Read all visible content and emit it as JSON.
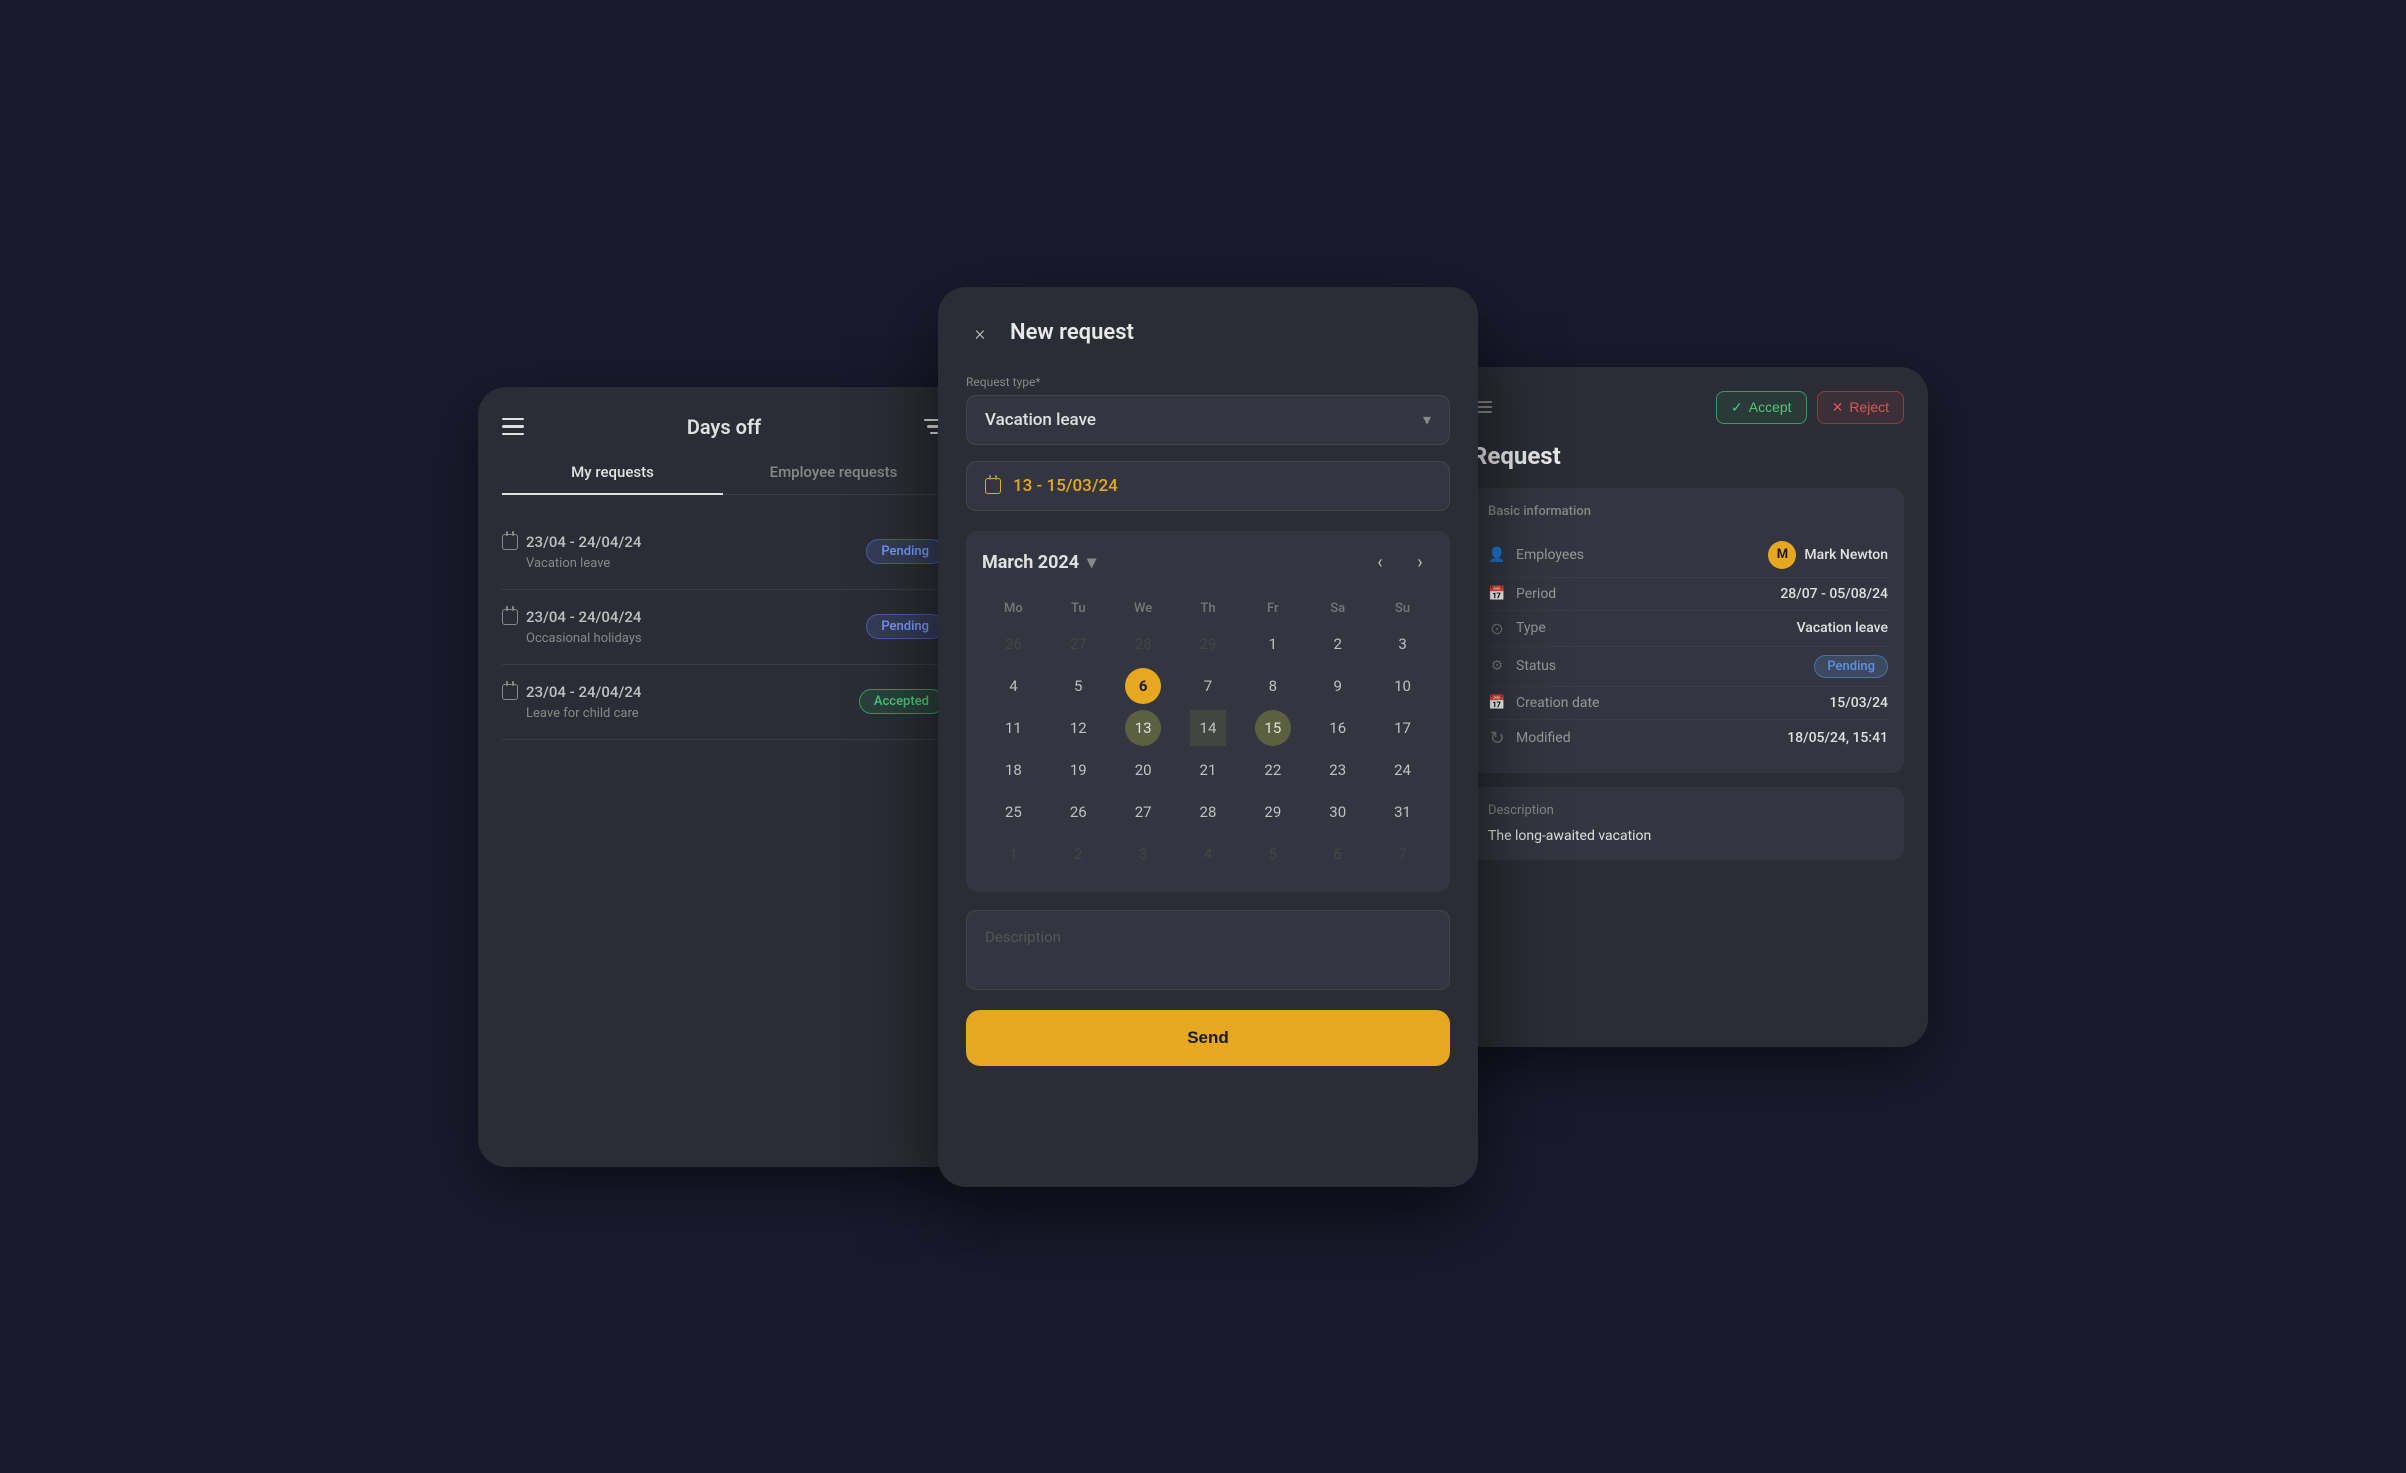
{
  "panel1": {
    "title": "Days off",
    "tabs": [
      {
        "label": "My requests",
        "active": true
      },
      {
        "label": "Employee requests",
        "active": false
      }
    ],
    "requests": [
      {
        "date": "23/04 - 24/04/24",
        "type": "Vacation leave",
        "status": "Pending",
        "statusType": "pending"
      },
      {
        "date": "23/04 - 24/04/24",
        "type": "Occasional holidays",
        "status": "Pending",
        "statusType": "pending"
      },
      {
        "date": "23/04 - 24/04/24",
        "type": "Leave for child care",
        "status": "Accepted",
        "statusType": "accepted"
      }
    ]
  },
  "panel2": {
    "title": "New request",
    "close_label": "×",
    "request_type_label": "Request type*",
    "request_type_value": "Vacation leave",
    "date_range": "13 - 15/03/24",
    "calendar": {
      "month": "March 2024",
      "weekdays": [
        "Mo",
        "Tu",
        "We",
        "Th",
        "Fr",
        "Sa",
        "Su"
      ],
      "rows": [
        [
          "26",
          "27",
          "28",
          "29",
          "1",
          "2",
          "3"
        ],
        [
          "4",
          "5",
          "6",
          "7",
          "8",
          "9",
          "10"
        ],
        [
          "11",
          "12",
          "13",
          "14",
          "15",
          "16",
          "17"
        ],
        [
          "18",
          "19",
          "20",
          "21",
          "22",
          "23",
          "24"
        ],
        [
          "25",
          "26",
          "27",
          "28",
          "29",
          "30",
          "31"
        ],
        [
          "1",
          "2",
          "3",
          "4",
          "5",
          "6",
          "7"
        ]
      ],
      "today_cell": "6",
      "selected_start": "13",
      "selected_end": "15",
      "in_range": [
        "14"
      ]
    },
    "description_placeholder": "Description",
    "send_label": "Send"
  },
  "panel3": {
    "section_title": "Request",
    "basic_info_label": "Basic information",
    "accept_label": "Accept",
    "reject_label": "Reject",
    "fields": [
      {
        "key": "Employees",
        "value": "Mark Newton",
        "icon": "person",
        "hasAvatar": true,
        "avatarLetter": "M"
      },
      {
        "key": "Period",
        "value": "28/07 - 05/08/24",
        "icon": "calendar",
        "hasAvatar": false
      },
      {
        "key": "Type",
        "value": "Vacation leave",
        "icon": "type",
        "hasAvatar": false
      },
      {
        "key": "Status",
        "value": "Pending",
        "icon": "status",
        "hasAvatar": false,
        "isStatus": true
      },
      {
        "key": "Creation date",
        "value": "15/03/24",
        "icon": "calendar",
        "hasAvatar": false
      },
      {
        "key": "Modified",
        "value": "18/05/24, 15:41",
        "icon": "modified",
        "hasAvatar": false
      }
    ],
    "description_label": "Description",
    "description_text": "The long-awaited vacation"
  }
}
